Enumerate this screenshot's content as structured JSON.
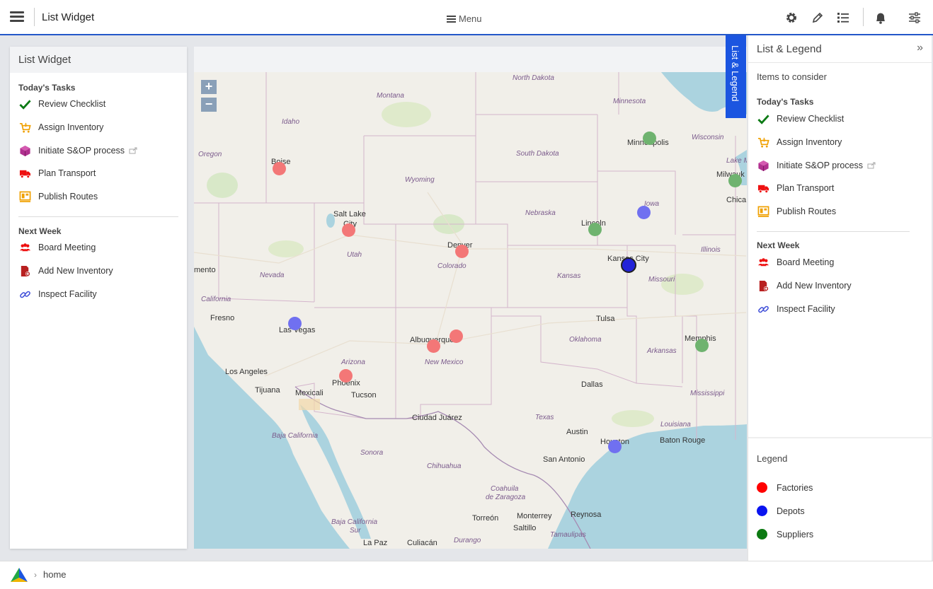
{
  "topbar": {
    "title": "List Widget",
    "menu_label": "Menu"
  },
  "left_panel": {
    "title": "List Widget",
    "today_title": "Today's Tasks",
    "today_items": [
      "Review Checklist",
      "Assign Inventory",
      "Initiate S&OP process",
      "Plan Transport",
      "Publish Routes"
    ],
    "next_title": "Next Week",
    "next_items": [
      "Board Meeting",
      "Add New Inventory",
      "Inspect Facility"
    ]
  },
  "map": {
    "zoom_in": "+",
    "zoom_out": "−",
    "cities": [
      "North Dakota",
      "Montana",
      "Minnesota",
      "Minneapolis",
      "Wisconsin",
      "Idaho",
      "Oregon",
      "Boise",
      "South Dakota",
      "Wyoming",
      "Lake M",
      "Milwauk",
      "Chica",
      "Salt Lake",
      "City",
      "Nebraska",
      "Lincoln",
      "Iowa",
      "Utah",
      "Denver",
      "Colorado",
      "Kansas City",
      "Illinois",
      "mento",
      "Nevada",
      "Kansas",
      "Missouri",
      "California",
      "Fresno",
      "Las Vegas",
      "Tulsa",
      "Oklahoma",
      "Memphis",
      "Albuquerque",
      "Arizona",
      "New Mexico",
      "Arkansas",
      "Los Angeles",
      "Phoenix",
      "Tucson",
      "Dallas",
      "Tijuana",
      "Mexicali",
      "Mississippi",
      "Ciudad Juárez",
      "Texas",
      "Baja California",
      "Sonora",
      "Austin",
      "Houston",
      "Louisiana",
      "Baton Rouge",
      "San Antonio",
      "Chihuahua",
      "Coahuila",
      "de Zaragoza",
      "Monterrey",
      "Reynosa",
      "Torreón",
      "Saltillo",
      "Baja California",
      "Sur",
      "La Paz",
      "Culiacán",
      "Durango",
      "Tamaulipas"
    ]
  },
  "legend_tab": "List & Legend",
  "right_panel": {
    "title": "List & Legend",
    "collapse_icon": "»",
    "subtitle": "Items to consider",
    "today_title": "Today's Tasks",
    "today_items": [
      "Review Checklist",
      "Assign Inventory",
      "Initiate S&OP process",
      "Plan Transport",
      "Publish Routes"
    ],
    "next_title": "Next Week",
    "next_items": [
      "Board Meeting",
      "Add New Inventory",
      "Inspect Facility"
    ],
    "legend_title": "Legend",
    "legend_items": [
      {
        "label": "Factories",
        "color": "#ff0000"
      },
      {
        "label": "Depots",
        "color": "#0a14f0"
      },
      {
        "label": "Suppliers",
        "color": "#0c7a12"
      }
    ]
  },
  "colors": {
    "factory_marker": "#f37777",
    "depot_marker": "#7070f0",
    "supplier_marker": "#6fb36f",
    "accent": "#1b55e0"
  },
  "footer": {
    "breadcrumb": "home"
  }
}
